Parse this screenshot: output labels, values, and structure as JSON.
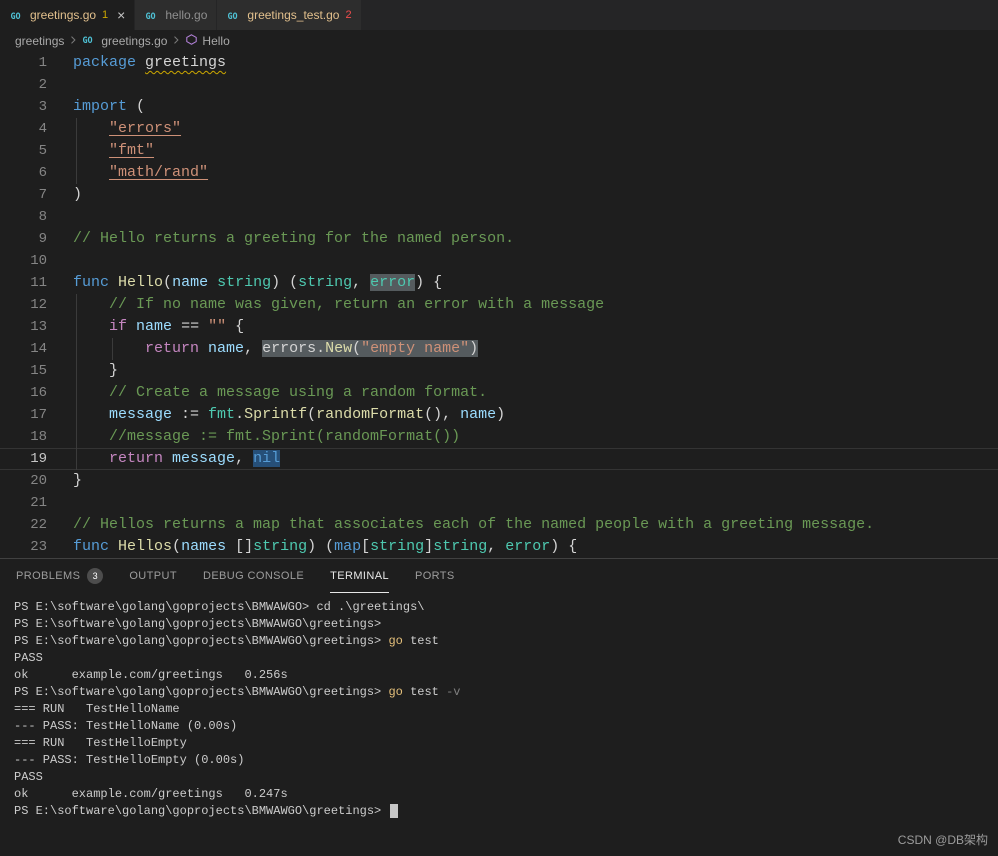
{
  "labels": {
    "close_glyph": "×"
  },
  "colors": {
    "go_icon": "#4fc3d7",
    "symbol_method": "#b180d7",
    "chevron": "#7a7a7a"
  },
  "tabs": [
    {
      "label": "greetings.go",
      "badge": "1",
      "active": true,
      "show_close": true,
      "label_color": "#e2c08d",
      "badge_color": "#cca700"
    },
    {
      "label": "hello.go",
      "badge": "",
      "active": false,
      "show_close": false,
      "label_color": "#8f8f8f",
      "badge_color": ""
    },
    {
      "label": "greetings_test.go",
      "badge": "2",
      "active": false,
      "show_close": false,
      "label_color": "#e2c08d",
      "badge_color": "#f14c4c"
    }
  ],
  "breadcrumb": {
    "items": [
      {
        "label": "greetings",
        "icon": ""
      },
      {
        "label": "greetings.go",
        "icon": "go"
      },
      {
        "label": "Hello",
        "icon": "method"
      }
    ]
  },
  "editor": {
    "token_colors": {
      "kw": "#569cd6",
      "ctrl": "#c586c0",
      "ty": "#4ec9b0",
      "fn": "#dcdcaa",
      "vr": "#9cdcfe",
      "str": "#ce9178",
      "cm": "#6a9955",
      "pl": "#d4d4d4"
    },
    "highlight_colors": {
      "wh": "#555b5e",
      "sel": "#264f78"
    },
    "squiggle_color": "#cca700",
    "lines": [
      {
        "n": 1,
        "segs": [
          {
            "t": "package",
            "c": "kw"
          },
          {
            "t": " ",
            "c": "pl"
          },
          {
            "t": "greetings",
            "c": "pl",
            "u": "wavy"
          }
        ]
      },
      {
        "n": 2,
        "segs": []
      },
      {
        "n": 3,
        "segs": [
          {
            "t": "import",
            "c": "kw"
          },
          {
            "t": " (",
            "c": "pl"
          }
        ]
      },
      {
        "n": 4,
        "guide": true,
        "segs": [
          {
            "t": "    ",
            "c": "pl"
          },
          {
            "t": "\"errors\"",
            "c": "str",
            "u": "link"
          }
        ]
      },
      {
        "n": 5,
        "guide": true,
        "segs": [
          {
            "t": "    ",
            "c": "pl"
          },
          {
            "t": "\"fmt\"",
            "c": "str",
            "u": "link"
          }
        ]
      },
      {
        "n": 6,
        "guide": true,
        "segs": [
          {
            "t": "    ",
            "c": "pl"
          },
          {
            "t": "\"math/rand\"",
            "c": "str",
            "u": "link"
          }
        ]
      },
      {
        "n": 7,
        "segs": [
          {
            "t": ")",
            "c": "pl"
          }
        ]
      },
      {
        "n": 8,
        "segs": []
      },
      {
        "n": 9,
        "segs": [
          {
            "t": "// Hello returns a greeting for the named person.",
            "c": "cm"
          }
        ]
      },
      {
        "n": 10,
        "segs": []
      },
      {
        "n": 11,
        "segs": [
          {
            "t": "func",
            "c": "kw"
          },
          {
            "t": " ",
            "c": "pl"
          },
          {
            "t": "Hello",
            "c": "fn"
          },
          {
            "t": "(",
            "c": "pl"
          },
          {
            "t": "name",
            "c": "vr"
          },
          {
            "t": " ",
            "c": "pl"
          },
          {
            "t": "string",
            "c": "ty"
          },
          {
            "t": ") (",
            "c": "pl"
          },
          {
            "t": "string",
            "c": "ty"
          },
          {
            "t": ", ",
            "c": "pl"
          },
          {
            "t": "error",
            "c": "ty",
            "h": "wh"
          },
          {
            "t": ") {",
            "c": "pl"
          }
        ]
      },
      {
        "n": 12,
        "guide": true,
        "segs": [
          {
            "t": "    ",
            "c": "pl"
          },
          {
            "t": "// If no name was given, return an error with a message",
            "c": "cm"
          }
        ]
      },
      {
        "n": 13,
        "guide": true,
        "segs": [
          {
            "t": "    ",
            "c": "pl"
          },
          {
            "t": "if",
            "c": "ctrl"
          },
          {
            "t": " ",
            "c": "pl"
          },
          {
            "t": "name",
            "c": "vr"
          },
          {
            "t": " == ",
            "c": "pl"
          },
          {
            "t": "\"\"",
            "c": "str"
          },
          {
            "t": " {",
            "c": "pl"
          }
        ]
      },
      {
        "n": 14,
        "guide": true,
        "guide2": true,
        "segs": [
          {
            "t": "        ",
            "c": "pl"
          },
          {
            "t": "return",
            "c": "ctrl"
          },
          {
            "t": " ",
            "c": "pl"
          },
          {
            "t": "name",
            "c": "vr"
          },
          {
            "t": ", ",
            "c": "pl"
          },
          {
            "t": "errors",
            "c": "pl",
            "h": "wh"
          },
          {
            "t": ".",
            "c": "pl",
            "h": "wh"
          },
          {
            "t": "New",
            "c": "fn",
            "h": "wh"
          },
          {
            "t": "(",
            "c": "pl",
            "h": "wh"
          },
          {
            "t": "\"empty name\"",
            "c": "str",
            "h": "wh"
          },
          {
            "t": ")",
            "c": "pl",
            "h": "wh"
          }
        ]
      },
      {
        "n": 15,
        "guide": true,
        "segs": [
          {
            "t": "    }",
            "c": "pl"
          }
        ]
      },
      {
        "n": 16,
        "guide": true,
        "segs": [
          {
            "t": "    ",
            "c": "pl"
          },
          {
            "t": "// Create a message using a random format.",
            "c": "cm"
          }
        ]
      },
      {
        "n": 17,
        "guide": true,
        "segs": [
          {
            "t": "    ",
            "c": "pl"
          },
          {
            "t": "message",
            "c": "vr"
          },
          {
            "t": " := ",
            "c": "pl"
          },
          {
            "t": "fmt",
            "c": "ty"
          },
          {
            "t": ".",
            "c": "pl"
          },
          {
            "t": "Sprintf",
            "c": "fn"
          },
          {
            "t": "(",
            "c": "pl"
          },
          {
            "t": "randomFormat",
            "c": "fn"
          },
          {
            "t": "(), ",
            "c": "pl"
          },
          {
            "t": "name",
            "c": "vr"
          },
          {
            "t": ")",
            "c": "pl"
          }
        ]
      },
      {
        "n": 18,
        "guide": true,
        "segs": [
          {
            "t": "    ",
            "c": "pl"
          },
          {
            "t": "//message := fmt.Sprint(randomFormat())",
            "c": "cm"
          }
        ]
      },
      {
        "n": 19,
        "guide": true,
        "cur": true,
        "segs": [
          {
            "t": "    ",
            "c": "pl"
          },
          {
            "t": "return",
            "c": "ctrl"
          },
          {
            "t": " ",
            "c": "pl"
          },
          {
            "t": "message",
            "c": "vr"
          },
          {
            "t": ", ",
            "c": "pl"
          },
          {
            "t": "nil",
            "c": "kw",
            "h": "sel"
          }
        ]
      },
      {
        "n": 20,
        "segs": [
          {
            "t": "}",
            "c": "pl"
          }
        ]
      },
      {
        "n": 21,
        "segs": []
      },
      {
        "n": 22,
        "segs": [
          {
            "t": "// Hellos returns a map that associates each of the named people with a greeting message.",
            "c": "cm"
          }
        ]
      },
      {
        "n": 23,
        "segs": [
          {
            "t": "func",
            "c": "kw"
          },
          {
            "t": " ",
            "c": "pl"
          },
          {
            "t": "Hellos",
            "c": "fn"
          },
          {
            "t": "(",
            "c": "pl"
          },
          {
            "t": "names",
            "c": "vr"
          },
          {
            "t": " []",
            "c": "pl"
          },
          {
            "t": "string",
            "c": "ty"
          },
          {
            "t": ") (",
            "c": "pl"
          },
          {
            "t": "map",
            "c": "kw"
          },
          {
            "t": "[",
            "c": "pl"
          },
          {
            "t": "string",
            "c": "ty"
          },
          {
            "t": "]",
            "c": "pl"
          },
          {
            "t": "string",
            "c": "ty"
          },
          {
            "t": ", ",
            "c": "pl"
          },
          {
            "t": "error",
            "c": "ty"
          },
          {
            "t": ") {",
            "c": "pl"
          }
        ]
      }
    ]
  },
  "panel": {
    "tabs": [
      {
        "label": "PROBLEMS",
        "badge": "3",
        "active": false
      },
      {
        "label": "OUTPUT",
        "badge": "",
        "active": false
      },
      {
        "label": "DEBUG CONSOLE",
        "badge": "",
        "active": false
      },
      {
        "label": "TERMINAL",
        "badge": "",
        "active": true
      },
      {
        "label": "PORTS",
        "badge": "",
        "active": false
      }
    ]
  },
  "terminal": {
    "colors": {
      "pl": "#cccccc",
      "cmd": "#e5c07b",
      "param": "#808080"
    },
    "lines": [
      {
        "segs": [
          {
            "t": "PS E:\\software\\golang\\goprojects\\BMWAWGO> cd .\\greetings\\",
            "c": "pl"
          }
        ]
      },
      {
        "segs": [
          {
            "t": "PS E:\\software\\golang\\goprojects\\BMWAWGO\\greetings> ",
            "c": "pl"
          }
        ]
      },
      {
        "segs": [
          {
            "t": "PS E:\\software\\golang\\goprojects\\BMWAWGO\\greetings> ",
            "c": "pl"
          },
          {
            "t": "go",
            "c": "cmd"
          },
          {
            "t": " test",
            "c": "pl"
          }
        ]
      },
      {
        "segs": [
          {
            "t": "PASS",
            "c": "pl"
          }
        ]
      },
      {
        "segs": [
          {
            "t": "ok      example.com/greetings   0.256s",
            "c": "pl"
          }
        ]
      },
      {
        "segs": [
          {
            "t": "PS E:\\software\\golang\\goprojects\\BMWAWGO\\greetings> ",
            "c": "pl"
          },
          {
            "t": "go",
            "c": "cmd"
          },
          {
            "t": " test ",
            "c": "pl"
          },
          {
            "t": "-v",
            "c": "param"
          }
        ]
      },
      {
        "segs": [
          {
            "t": "=== RUN   TestHelloName",
            "c": "pl"
          }
        ]
      },
      {
        "segs": [
          {
            "t": "--- PASS: TestHelloName (0.00s)",
            "c": "pl"
          }
        ]
      },
      {
        "segs": [
          {
            "t": "=== RUN   TestHelloEmpty",
            "c": "pl"
          }
        ]
      },
      {
        "segs": [
          {
            "t": "--- PASS: TestHelloEmpty (0.00s)",
            "c": "pl"
          }
        ]
      },
      {
        "segs": [
          {
            "t": "PASS",
            "c": "pl"
          }
        ]
      },
      {
        "segs": [
          {
            "t": "ok      example.com/greetings   0.247s",
            "c": "pl"
          }
        ]
      },
      {
        "cursor": true,
        "segs": [
          {
            "t": "PS E:\\software\\golang\\goprojects\\BMWAWGO\\greetings> ",
            "c": "pl"
          }
        ]
      }
    ]
  },
  "watermark": "CSDN @DB架构"
}
